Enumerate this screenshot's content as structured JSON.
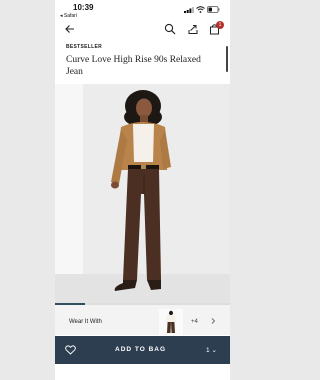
{
  "status_bar": {
    "time": "10:39",
    "back_app": "◂ Safari"
  },
  "header": {
    "icons": [
      "back-arrow-icon",
      "search-icon",
      "share-icon",
      "bag-icon"
    ],
    "bag_count": "1"
  },
  "product": {
    "badge": "BESTSELLER",
    "title": "Curve Love High Rise 90s Relaxed Jean"
  },
  "gallery": {
    "image_label": "model-wearing-brown-jeans-and-tan-jacket",
    "progress": 0.17
  },
  "wear_it_with": {
    "label": "Wear It With",
    "more": "+4"
  },
  "cta": {
    "add_label": "ADD TO BAG",
    "quantity": "1"
  },
  "colors": {
    "cta_bg": "#2c3e50",
    "badge_red": "#b5302a",
    "jeans_brown": "#4a2f22",
    "jacket_tan": "#b9844c"
  }
}
